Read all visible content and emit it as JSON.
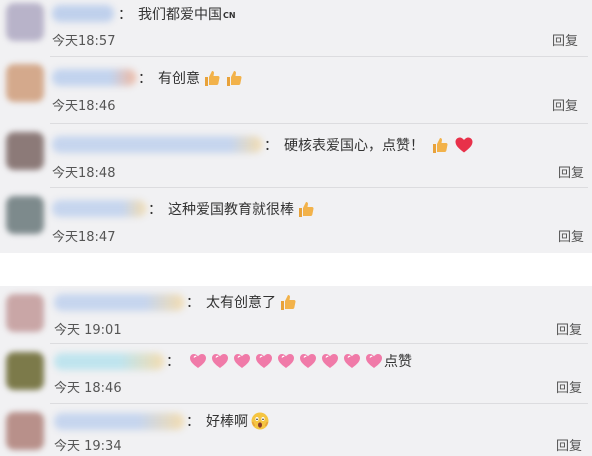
{
  "comments": [
    {
      "text": "我们都爱中国",
      "flag": "CN",
      "time": "今天18:57",
      "reply": "回复"
    },
    {
      "text": "有创意",
      "time": "今天18:46",
      "reply": "回复"
    },
    {
      "text": "硬核表爱国心，点赞！",
      "time": "今天18:48",
      "reply": "回复"
    },
    {
      "text": "这种爱国教育就很棒",
      "time": "今天18:47",
      "reply": "回复"
    },
    {
      "text": "太有创意了",
      "time": "今天 19:01",
      "reply": "回复"
    },
    {
      "text_suffix": "点赞",
      "time": "今天 18:46",
      "reply": "回复"
    },
    {
      "text": "好棒啊",
      "time": "今天 19:34",
      "reply": "回复"
    }
  ],
  "separator": "：",
  "colors": {
    "panel_bg": "#f1f1f3",
    "heart": "#e8314a",
    "thumb": "#f2b24a",
    "pink_heart": "#f07aa8"
  }
}
